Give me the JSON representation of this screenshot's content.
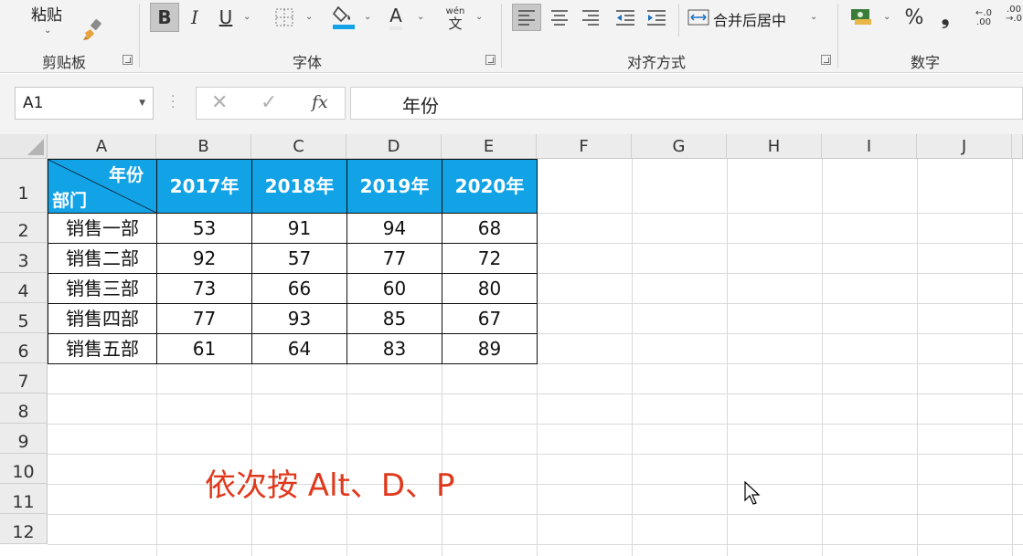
{
  "ribbon": {
    "clipboard": {
      "paste_label": "粘贴",
      "group_label": "剪贴板"
    },
    "font": {
      "group_label": "字体",
      "bold_label": "B",
      "italic_label": "I",
      "underline_label": "U",
      "font_color_label": "A",
      "phonetic_top": "wén",
      "phonetic_bottom": "文"
    },
    "alignment": {
      "group_label": "对齐方式",
      "merge_label": "合并后居中"
    },
    "number": {
      "group_label": "数字",
      "percent_label": "%",
      "comma_label": "❟",
      "inc_decimal_top": "←.0",
      "inc_decimal_bottom": ".00",
      "dec_decimal_top": ".00",
      "dec_decimal_bottom": "→.0"
    }
  },
  "formula_bar": {
    "name_box": "A1",
    "cancel": "✕",
    "enter": "✓",
    "fx": "fx",
    "content": "年份"
  },
  "columns": [
    "A",
    "B",
    "C",
    "D",
    "E",
    "F",
    "G",
    "H",
    "I",
    "J"
  ],
  "rows": [
    "1",
    "2",
    "3",
    "4",
    "5",
    "6",
    "7",
    "8",
    "9",
    "10",
    "11",
    "12"
  ],
  "table": {
    "corner_top": "年份",
    "corner_bottom": "部门",
    "years": [
      "2017年",
      "2018年",
      "2019年",
      "2020年"
    ],
    "records": [
      {
        "dept": "销售一部",
        "values": [
          "53",
          "91",
          "94",
          "68"
        ]
      },
      {
        "dept": "销售二部",
        "values": [
          "92",
          "57",
          "77",
          "72"
        ]
      },
      {
        "dept": "销售三部",
        "values": [
          "73",
          "66",
          "60",
          "80"
        ]
      },
      {
        "dept": "销售四部",
        "values": [
          "77",
          "93",
          "85",
          "67"
        ]
      },
      {
        "dept": "销售五部",
        "values": [
          "61",
          "64",
          "83",
          "89"
        ]
      }
    ]
  },
  "annotation": "依次按 Alt、D、P",
  "colors": {
    "header_fill": "#12a2e6",
    "annotation": "#e0381c",
    "ribbon_bg": "#f3f3f3"
  }
}
